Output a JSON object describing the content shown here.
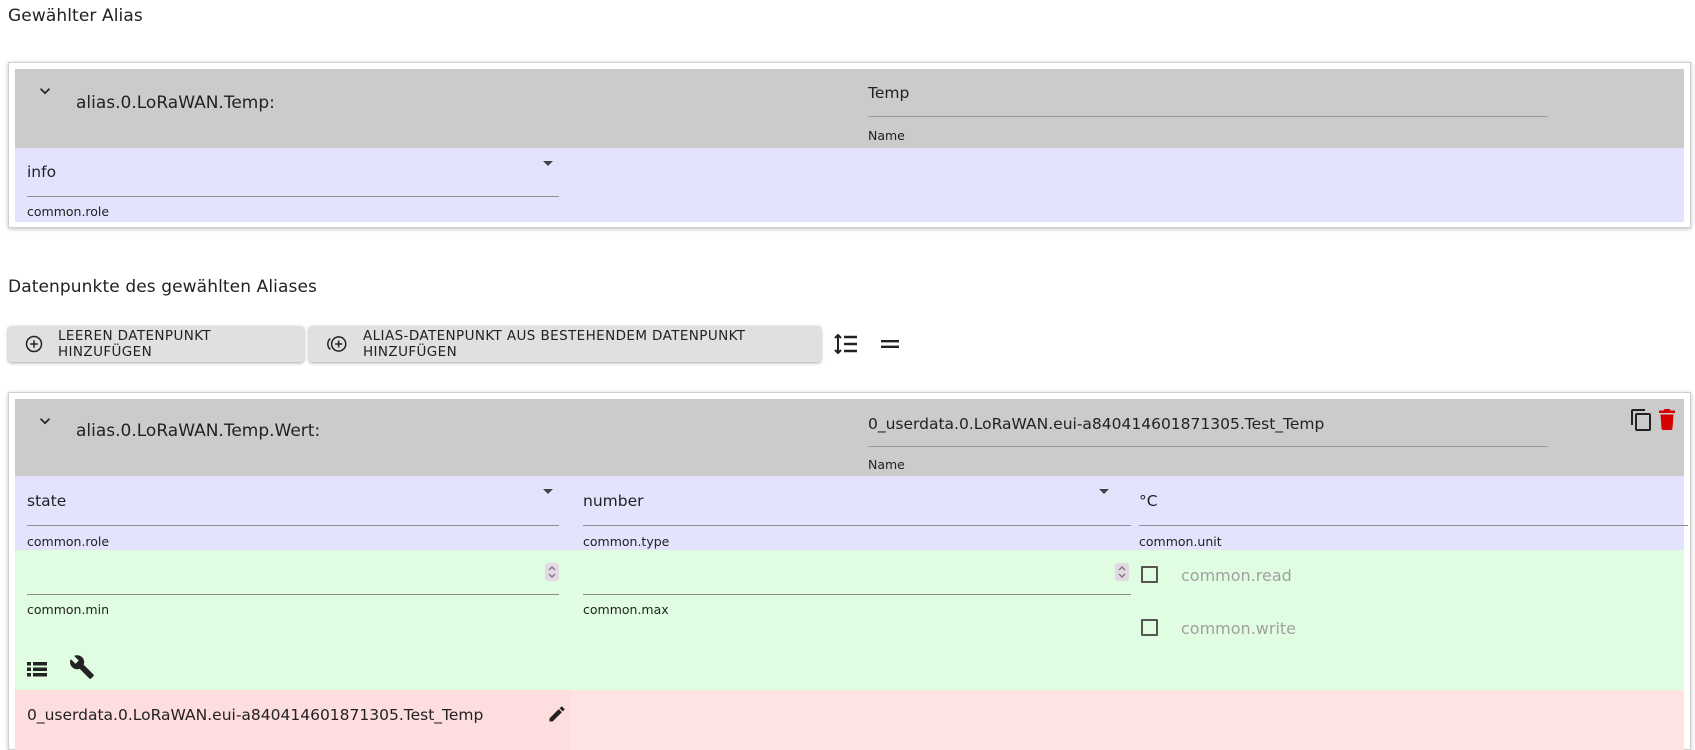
{
  "selected_alias": {
    "heading": "Gewählter Alias",
    "id": "alias.0.LoRaWAN.Temp:",
    "name_value": "Temp",
    "name_label": "Name",
    "role_value": "info",
    "role_label": "common.role"
  },
  "datapoints": {
    "heading": "Datenpunkte des gewählten Aliases",
    "toolbar": {
      "add_empty_label": "LEEREN DATENPUNKT HINZUFÜGEN",
      "add_from_existing_label": "ALIAS-DATENPUNKT AUS BESTEHENDEM DATENPUNKT HINZUFÜGEN"
    },
    "item": {
      "id": "alias.0.LoRaWAN.Temp.Wert:",
      "name_value": "0_userdata.0.LoRaWAN.eui-a840414601871305.Test_Temp",
      "name_label": "Name",
      "role_value": "state",
      "role_label": "common.role",
      "type_value": "number",
      "type_label": "common.type",
      "unit_value": "°C",
      "unit_label": "common.unit",
      "min_value": "",
      "min_label": "common.min",
      "max_value": "",
      "max_label": "common.max",
      "read_label": "common.read",
      "read_checked": false,
      "write_label": "common.write",
      "write_checked": false,
      "source_id": "0_userdata.0.LoRaWAN.eui-a840414601871305.Test_Temp"
    }
  },
  "colors": {
    "header_gray": "#cbcbcb",
    "section_blue": "#e3e3fd",
    "section_green": "#e1fde1",
    "section_red": "#fddddd",
    "delete_red": "#d50000"
  }
}
